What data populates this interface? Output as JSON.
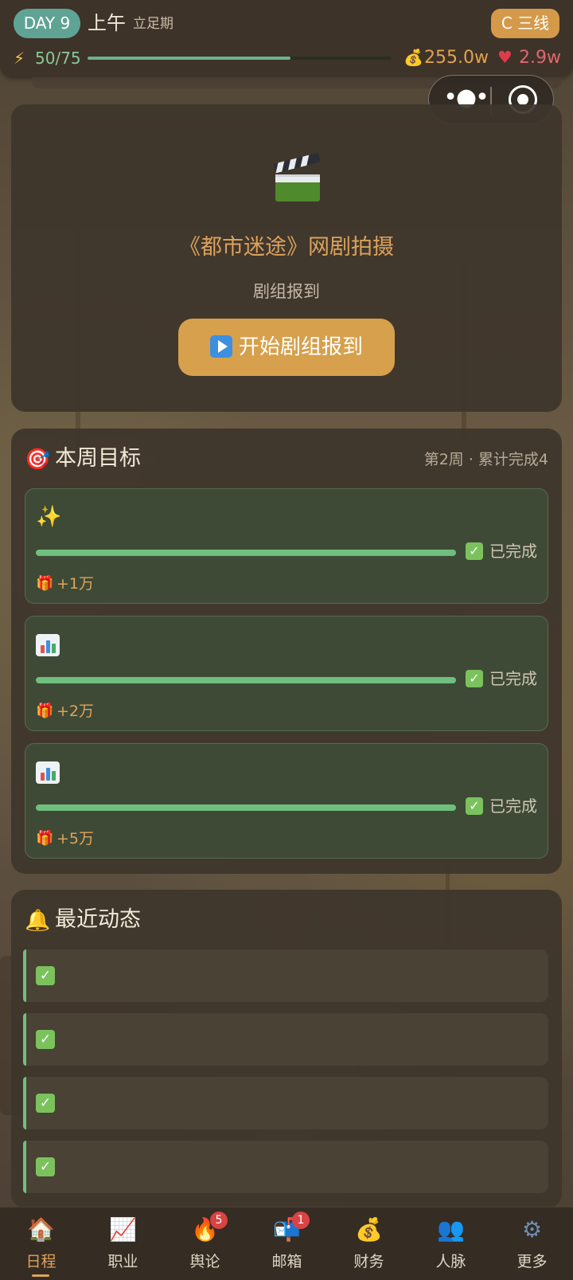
{
  "status": {
    "day": "DAY 9",
    "period": "上午",
    "phase": "立足期",
    "tier": "C 三线",
    "energy_text": "50/75",
    "energy_fraction": 0.667,
    "money": "255.0w",
    "fans": "2.9w"
  },
  "event": {
    "title": "《都市迷途》网剧拍摄",
    "subtitle": "剧组报到",
    "button_label": "开始剧组报到"
  },
  "weekly_goals": {
    "title": "本周目标",
    "meta": "第2周 · 累计完成4",
    "goals": [
      {
        "icon": "sparkles-icon",
        "progress": 1.0,
        "status": "已完成",
        "reward": "+1万"
      },
      {
        "icon": "bar-chart-icon",
        "progress": 1.0,
        "status": "已完成",
        "reward": "+2万"
      },
      {
        "icon": "bar-chart-icon",
        "progress": 1.0,
        "status": "已完成",
        "reward": "+5万"
      }
    ]
  },
  "recent_activity": {
    "title": "最近动态",
    "item_count_visible": 4
  },
  "nav": {
    "items": [
      {
        "label": "日程",
        "icon": "house-icon",
        "active": true
      },
      {
        "label": "职业",
        "icon": "chart-up-icon"
      },
      {
        "label": "舆论",
        "icon": "fire-icon",
        "badge": "5"
      },
      {
        "label": "邮箱",
        "icon": "mailbox-icon",
        "badge": "1"
      },
      {
        "label": "财务",
        "icon": "money-bag-icon"
      },
      {
        "label": "人脉",
        "icon": "people-icon"
      },
      {
        "label": "更多",
        "icon": "gear-icon"
      }
    ]
  },
  "colors": {
    "accent": "#d7a04c",
    "success": "#6fbf7e",
    "badge": "#d94343",
    "teal": "#5fa394"
  }
}
